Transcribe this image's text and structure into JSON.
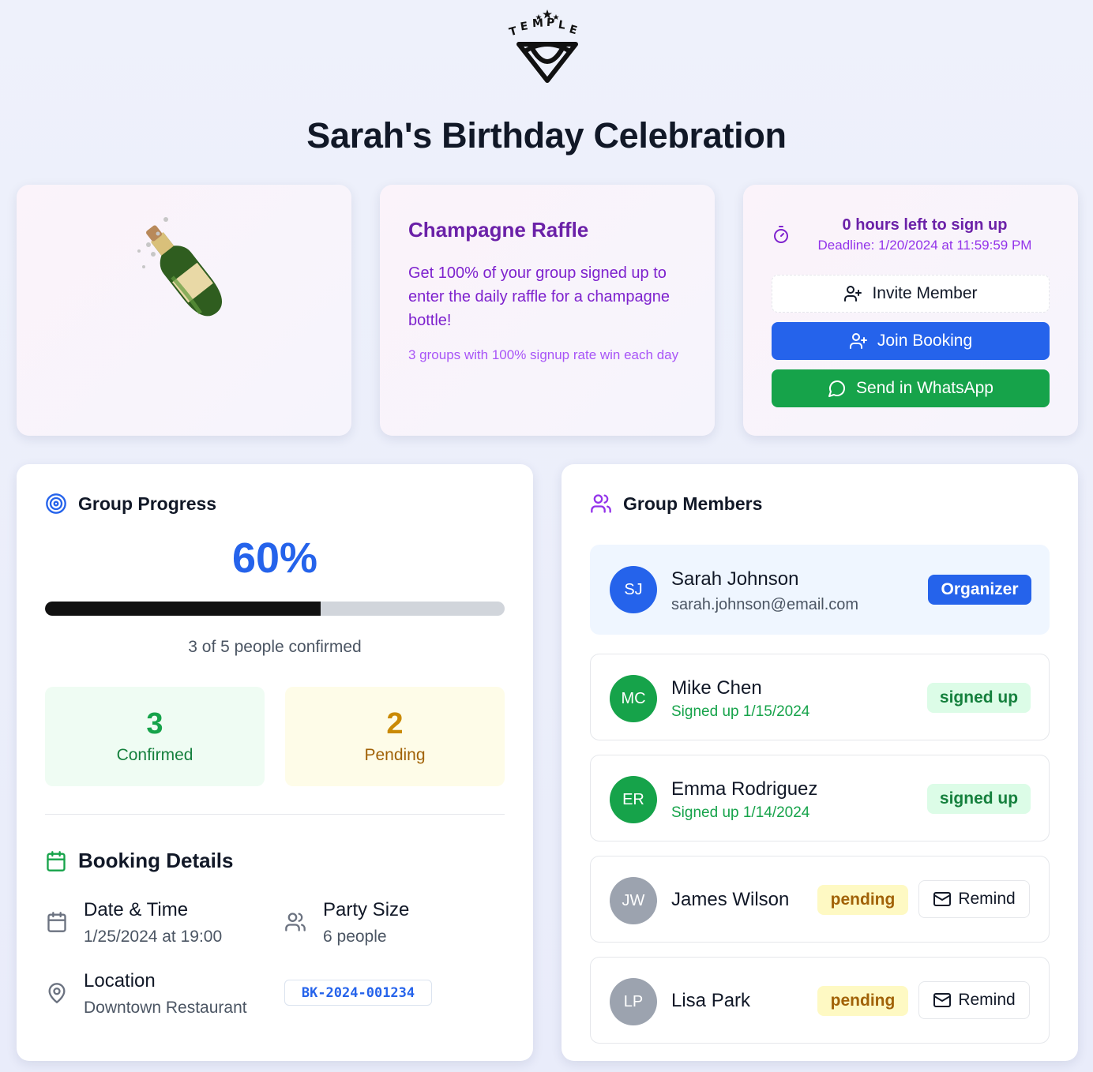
{
  "brand": {
    "logo_text": "TEMPLE"
  },
  "page_title": "Sarah's Birthday Celebration",
  "raffle": {
    "title": "Champagne Raffle",
    "description": "Get 100% of your group signed up to enter the daily raffle for a champagne bottle!",
    "note": "3 groups with 100% signup rate win each day"
  },
  "signup": {
    "hours_left": "0 hours left to sign up",
    "deadline": "Deadline: 1/20/2024 at 11:59:59 PM",
    "invite_label": "Invite Member",
    "join_label": "Join Booking",
    "whatsapp_label": "Send in WhatsApp"
  },
  "progress": {
    "title": "Group Progress",
    "percent_label": "60%",
    "percent_value": 0.6,
    "confirmed_text": "3 of 5 people confirmed",
    "confirmed_count": "3",
    "confirmed_label": "Confirmed",
    "pending_count": "2",
    "pending_label": "Pending"
  },
  "booking": {
    "title": "Booking Details",
    "date_title": "Date & Time",
    "date_value": "1/25/2024 at 19:00",
    "party_title": "Party Size",
    "party_value": "6 people",
    "location_title": "Location",
    "location_value": "Downtown Restaurant",
    "booking_id": "BK-2024-001234"
  },
  "members": {
    "title": "Group Members",
    "remind_label": "Remind",
    "list": [
      {
        "initials": "SJ",
        "name": "Sarah Johnson",
        "sub": "sarah.johnson@email.com",
        "badge": "Organizer",
        "avatar_color": "#2563eb"
      },
      {
        "initials": "MC",
        "name": "Mike Chen",
        "sub": "Signed up 1/15/2024",
        "badge": "signed up",
        "avatar_color": "#16a34a"
      },
      {
        "initials": "ER",
        "name": "Emma Rodriguez",
        "sub": "Signed up 1/14/2024",
        "badge": "signed up",
        "avatar_color": "#16a34a"
      },
      {
        "initials": "JW",
        "name": "James Wilson",
        "sub": "",
        "badge": "pending",
        "avatar_color": "#9ca3af"
      },
      {
        "initials": "LP",
        "name": "Lisa Park",
        "sub": "",
        "badge": "pending",
        "avatar_color": "#9ca3af"
      }
    ]
  },
  "colors": {
    "primary": "#2563eb",
    "success": "#16a34a",
    "warning": "#ca8a04",
    "purple": "#6b21a8"
  },
  "icons": [
    "temple-logo-icon",
    "champagne-bottle-icon",
    "timer-icon",
    "user-plus-icon",
    "message-circle-icon",
    "target-icon",
    "calendar-icon",
    "users-icon",
    "map-pin-icon",
    "mail-icon"
  ]
}
